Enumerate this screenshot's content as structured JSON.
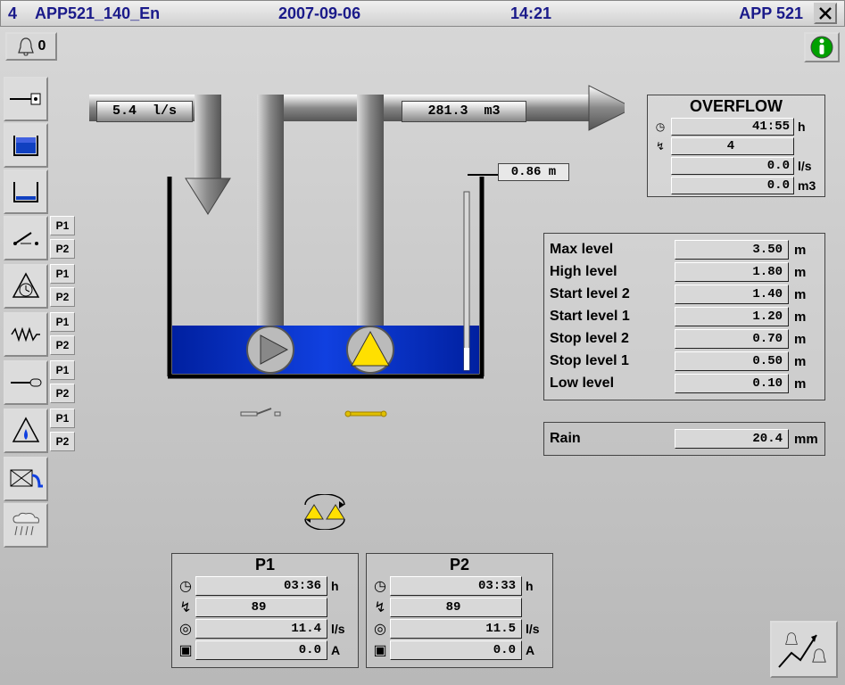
{
  "header": {
    "index": "4",
    "title": "APP521_140_En",
    "date": "2007-09-06",
    "time": "14:21",
    "app": "APP 521"
  },
  "alarm": {
    "count": "0"
  },
  "sidebar": {
    "p1_label": "P1",
    "p2_label": "P2"
  },
  "flow": {
    "inflow_value": "5.4",
    "inflow_unit": "l/s",
    "outflow_value": "281.3",
    "outflow_unit": "m3",
    "level_value": "0.86",
    "level_unit": "m"
  },
  "overflow": {
    "title": "OVERFLOW",
    "hours_value": "41:55",
    "hours_unit": "h",
    "count_value": "4",
    "rate_value": "0.0",
    "rate_unit": "l/s",
    "volume_value": "0.0",
    "volume_unit": "m3"
  },
  "levels": {
    "rows": [
      {
        "label": "Max level",
        "value": "3.50",
        "unit": "m"
      },
      {
        "label": "High level",
        "value": "1.80",
        "unit": "m"
      },
      {
        "label": "Start level 2",
        "value": "1.40",
        "unit": "m"
      },
      {
        "label": "Start level 1",
        "value": "1.20",
        "unit": "m"
      },
      {
        "label": "Stop level 2",
        "value": "0.70",
        "unit": "m"
      },
      {
        "label": "Stop level 1",
        "value": "0.50",
        "unit": "m"
      },
      {
        "label": "Low level",
        "value": "0.10",
        "unit": "m"
      }
    ]
  },
  "rain": {
    "label": "Rain",
    "value": "20.4",
    "unit": "mm"
  },
  "pumps": {
    "p1": {
      "title": "P1",
      "hours_value": "03:36",
      "hours_unit": "h",
      "starts_value": "89",
      "flow_value": "11.4",
      "flow_unit": "l/s",
      "current_value": "0.0",
      "current_unit": "A"
    },
    "p2": {
      "title": "P2",
      "hours_value": "03:33",
      "hours_unit": "h",
      "starts_value": "89",
      "flow_value": "11.5",
      "flow_unit": "l/s",
      "current_value": "0.0",
      "current_unit": "A"
    }
  }
}
